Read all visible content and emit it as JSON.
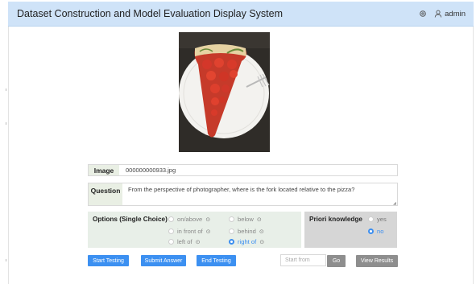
{
  "header": {
    "title": "Dataset Construction and Model Evaluation Display System",
    "user": "admin",
    "icons": [
      "gear-icon",
      "user-icon"
    ]
  },
  "image_row": {
    "label": "Image",
    "value": "000000000933.jpg"
  },
  "question_row": {
    "label": "Question",
    "value": "From the perspective of photographer, where is the fork located relative to the pizza?"
  },
  "options": {
    "title": "Options (Single Choice)",
    "items": [
      {
        "label": "on/above",
        "selected": false
      },
      {
        "label": "below",
        "selected": false
      },
      {
        "label": "in front of",
        "selected": false
      },
      {
        "label": "behind",
        "selected": false
      },
      {
        "label": "left of",
        "selected": false
      },
      {
        "label": "right of",
        "selected": true
      }
    ]
  },
  "prior": {
    "title": "Priori knowledge",
    "items": [
      {
        "label": "yes",
        "selected": false
      },
      {
        "label": "no",
        "selected": true
      }
    ]
  },
  "buttons": {
    "start": "Start Testing",
    "submit": "Submit Answer",
    "end": "End Testing",
    "go": "Go",
    "view": "View Results"
  },
  "start_from": {
    "placeholder": "Start from",
    "value": ""
  },
  "colors": {
    "header_bg": "#cfe3f8",
    "accent": "#3c90f1",
    "label_bg": "#e9efe4",
    "options_bg": "#e8efe8",
    "prior_bg": "#d6d6d6",
    "gray_button": "#8e8e8e"
  }
}
